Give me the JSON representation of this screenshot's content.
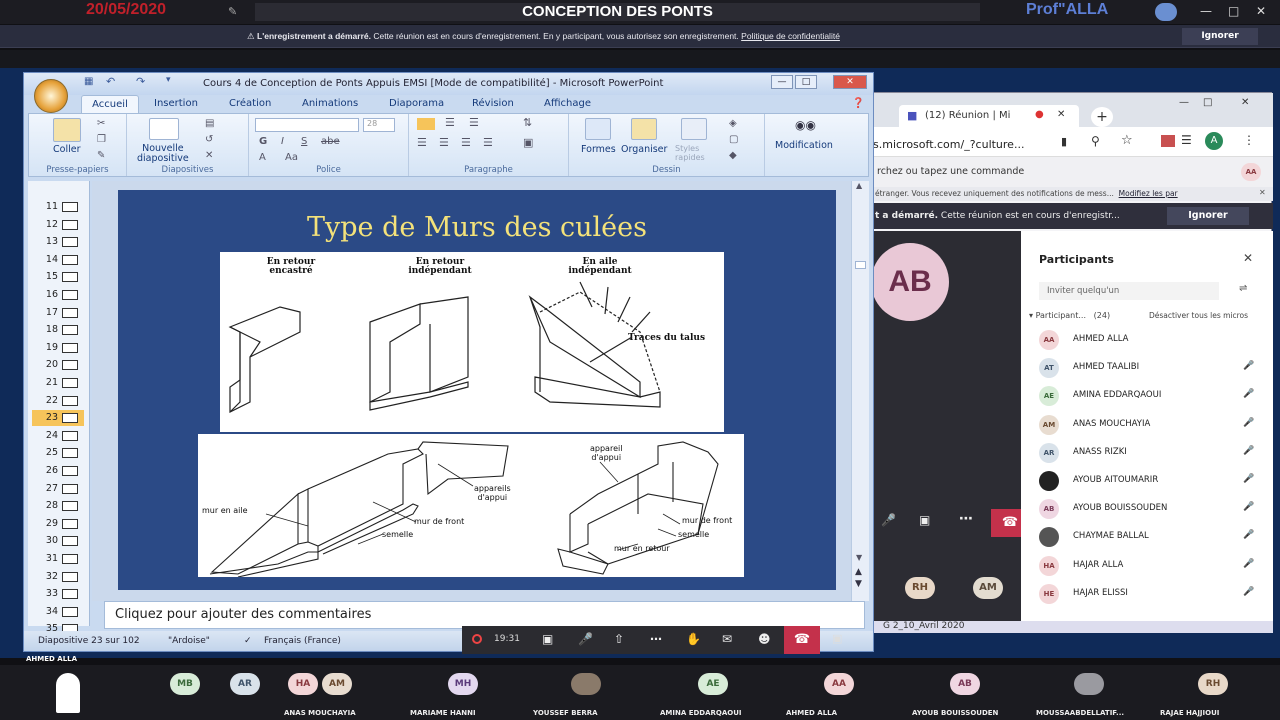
{
  "meeting": {
    "date": "20/05/2020",
    "title": "CONCEPTION DES PONTS",
    "presenter_label": "Prof\"ALLA",
    "recording_bold": "L'enregistrement a démarré.",
    "recording_text": " Cette réunion est en cours d'enregistrement. En y participant, vous autorisez son enregistrement.",
    "recording_link": "Politique de confidentialité",
    "ignore": "Ignorer",
    "presenter_name": "AHMED ALLA"
  },
  "browser": {
    "tab_title": "(12) Réunion | Mi",
    "url": "s.microsoft.com/_?culture...",
    "search_placeholder": "rchez ou tapez une commande",
    "notif_text": "étranger. Vous recevez uniquement des notifications de mess...",
    "notif_link": "Modifiez les par",
    "rec_bold": "t a démarré.",
    "rec_text": " Cette réunion est en cours d'enregistr...",
    "ignore": "Ignorer",
    "avatar": "AB",
    "avatar_rh": "RH",
    "avatar_am": "AM",
    "user_initial": "A",
    "user_badge": "AA",
    "footer_text": "G 2_10_Avril 2020"
  },
  "participants": {
    "title": "Participants",
    "invite_placeholder": "Inviter quelqu'un",
    "section_label": "Participant...",
    "section_count": "(24)",
    "mute_all": "Désactiver tous les micros",
    "list": [
      {
        "initials": "AA",
        "name": "AHMED ALLA",
        "color": "#f3d6d8",
        "fg": "#8a3a40"
      },
      {
        "initials": "AT",
        "name": "AHMED TAALIBI",
        "color": "#d9e2ea",
        "fg": "#40546a"
      },
      {
        "initials": "AE",
        "name": "AMINA EDDARQAOUI",
        "color": "#d8ecd8",
        "fg": "#3b6b3b"
      },
      {
        "initials": "AM",
        "name": "ANAS MOUCHAYIA",
        "color": "#e8dcd0",
        "fg": "#6a4a30"
      },
      {
        "initials": "AR",
        "name": "ANASS RIZKI",
        "color": "#d9e2ea",
        "fg": "#40546a"
      },
      {
        "initials": "",
        "name": "AYOUB AITOUMARIR",
        "color": "#222222",
        "fg": "#ffffff"
      },
      {
        "initials": "AB",
        "name": "AYOUB BOUISSOUDEN",
        "color": "#efd6e2",
        "fg": "#7a3a58"
      },
      {
        "initials": "",
        "name": "CHAYMAE BALLAL",
        "color": "#555555",
        "fg": "#ffffff"
      },
      {
        "initials": "HA",
        "name": "HAJAR ALLA",
        "color": "#f3d6d8",
        "fg": "#8a3a40"
      },
      {
        "initials": "HE",
        "name": "HAJAR ELISSI",
        "color": "#f3d6d8",
        "fg": "#8a3a40"
      }
    ]
  },
  "ppt": {
    "window_title": "Cours 4 de Conception de Ponts Appuis EMSI [Mode de compatibilité] - Microsoft PowerPoint",
    "tabs": [
      "Accueil",
      "Insertion",
      "Création",
      "Animations",
      "Diaporama",
      "Révision",
      "Affichage"
    ],
    "groups": {
      "clipboard": "Presse-papiers",
      "slides": "Diapositives",
      "font": "Police",
      "paragraph": "Paragraphe",
      "drawing": "Dessin"
    },
    "buttons": {
      "paste": "Coller",
      "new_slide": "Nouvelle\ndiapositive",
      "shapes": "Formes",
      "arrange": "Organiser",
      "quick_styles": "Styles\nrapides",
      "modification": "Modification",
      "font_size": "28"
    },
    "slide_numbers": [
      "11",
      "12",
      "13",
      "14",
      "15",
      "16",
      "17",
      "18",
      "19",
      "20",
      "21",
      "22",
      "23",
      "24",
      "25",
      "26",
      "27",
      "28",
      "29",
      "30",
      "31",
      "32",
      "33",
      "34",
      "35"
    ],
    "current_slide": "23",
    "slide": {
      "title": "Type de Murs des culées",
      "label_retour": "En retour\nencastré",
      "label_independant": "En retour\nindépendant",
      "label_aile": "En aile\nindépendant",
      "label_talus": "Traces du talus",
      "label_mur_aile": "mur en aile",
      "label_appareils": "appareils\nd'appui",
      "label_mur_front": "mur de front",
      "label_semelle": "semelle",
      "label_appareil": "appareil\nd'appui",
      "label_mur_front2": "mur de front",
      "label_semelle2": "semelle",
      "label_mur_retour": "mur en retour"
    },
    "notes_placeholder": "Cliquez pour ajouter des commentaires",
    "status": {
      "slide_of": "Diapositive 23 sur 102",
      "theme": "\"Ardoise\"",
      "language": "Français (France)"
    }
  },
  "controls": {
    "time": "19:31"
  },
  "bottom_tiles": [
    {
      "initials": "",
      "name": "",
      "color": "#ffffff",
      "fg": "#000"
    },
    {
      "initials": "MB",
      "name": "",
      "color": "#d8ecd8",
      "fg": "#3b6b3b"
    },
    {
      "initials": "AR",
      "name": "",
      "color": "#d9e2ea",
      "fg": "#40546a"
    },
    {
      "initials": "HA",
      "name": "",
      "color": "#f3d6d8",
      "fg": "#8a3a40"
    },
    {
      "initials": "AM",
      "name": "ANAS MOUCHAYIA",
      "color": "#e8dcd0",
      "fg": "#6a4a30"
    },
    {
      "initials": "MH",
      "name": "MARIAME HANNI",
      "color": "#e3d8ef",
      "fg": "#5a3a7a"
    },
    {
      "initials": "",
      "name": "YOUSSEF BERRA",
      "color": "#8a7a6a",
      "fg": "#fff"
    },
    {
      "initials": "AE",
      "name": "AMINA EDDARQAOUI",
      "color": "#d8ecd8",
      "fg": "#3b6b3b"
    },
    {
      "initials": "AA",
      "name": "AHMED ALLA",
      "color": "#f3d6d8",
      "fg": "#8a3a40"
    },
    {
      "initials": "AB",
      "name": "AYOUB BOUISSOUDEN",
      "color": "#efd6e2",
      "fg": "#7a3a58"
    },
    {
      "initials": "",
      "name": "MOUSSAABDELLATIF...",
      "color": "#9a9aa0",
      "fg": "#fff"
    },
    {
      "initials": "RH",
      "name": "RAJAE HAJJIOUI",
      "color": "#e8d8c8",
      "fg": "#6a4a30"
    }
  ]
}
